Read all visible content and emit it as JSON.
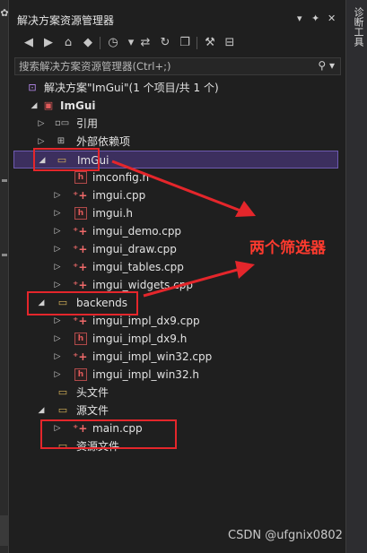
{
  "left_strip": {
    "glyph": "✿"
  },
  "right_strip": {
    "vertical_tab": "诊断工具"
  },
  "window": {
    "title": "解决方案资源管理器",
    "buttons": {
      "dropdown": "▾",
      "pin": "✦",
      "close": "✕"
    }
  },
  "toolbar": {
    "icons": [
      "back-icon",
      "forward-icon",
      "home-icon",
      "vs-switch-icon",
      "history-icon",
      "sync-icon",
      "refresh-icon",
      "collapse-all-icon",
      "properties-icon",
      "preview-icon"
    ]
  },
  "search": {
    "placeholder": "搜索解决方案资源管理器(Ctrl+;)",
    "icon": "search-icon"
  },
  "tree": [
    {
      "label": "解决方案\"ImGui\"(1 个项目/共 1 个)",
      "icon": "solution-icon",
      "arrow": ""
    },
    {
      "label": "ImGui",
      "icon": "project-icon",
      "arrow": "◢"
    },
    {
      "label": "引用",
      "icon": "references-icon",
      "arrow": "▷"
    },
    {
      "label": "外部依赖项",
      "icon": "external-deps-icon",
      "arrow": "▷"
    },
    {
      "label": "ImGui",
      "icon": "filter-folder-icon",
      "arrow": "◢"
    },
    {
      "label": "imconfig.h",
      "icon": "header-file-icon",
      "arrow": ""
    },
    {
      "label": "imgui.cpp",
      "icon": "cpp-file-icon",
      "arrow": "▷"
    },
    {
      "label": "imgui.h",
      "icon": "header-file-icon",
      "arrow": "▷"
    },
    {
      "label": "imgui_demo.cpp",
      "icon": "cpp-file-icon",
      "arrow": "▷"
    },
    {
      "label": "imgui_draw.cpp",
      "icon": "cpp-file-icon",
      "arrow": "▷"
    },
    {
      "label": "imgui_tables.cpp",
      "icon": "cpp-file-icon",
      "arrow": "▷"
    },
    {
      "label": "imgui_widgets.cpp",
      "icon": "cpp-file-icon",
      "arrow": "▷"
    },
    {
      "label": "backends",
      "icon": "filter-folder-icon",
      "arrow": "◢"
    },
    {
      "label": "imgui_impl_dx9.cpp",
      "icon": "cpp-file-icon",
      "arrow": "▷"
    },
    {
      "label": "imgui_impl_dx9.h",
      "icon": "header-file-icon",
      "arrow": "▷"
    },
    {
      "label": "imgui_impl_win32.cpp",
      "icon": "cpp-file-icon",
      "arrow": "▷"
    },
    {
      "label": "imgui_impl_win32.h",
      "icon": "header-file-icon",
      "arrow": "▷"
    },
    {
      "label": "头文件",
      "icon": "filter-folder-icon",
      "arrow": ""
    },
    {
      "label": "源文件",
      "icon": "filter-folder-icon",
      "arrow": "◢"
    },
    {
      "label": "main.cpp",
      "icon": "cpp-file-icon",
      "arrow": "▷"
    },
    {
      "label": "资源文件",
      "icon": "filter-folder-icon",
      "arrow": ""
    }
  ],
  "annotation": {
    "text": "两个筛选器"
  },
  "watermark": "CSDN @ufgnix0802",
  "colors": {
    "selection_bg": "#3c2f5e",
    "selection_border": "#6e5bb0",
    "annotation_red": "#e4262b"
  }
}
